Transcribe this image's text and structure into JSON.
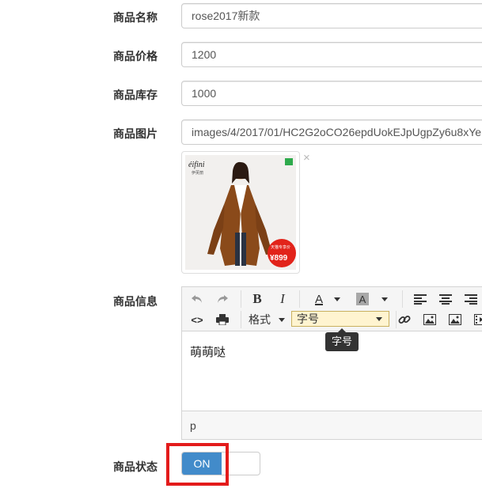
{
  "form": {
    "name_label": "商品名称",
    "name_value": "rose2017新款",
    "price_label": "商品价格",
    "price_value": "1200",
    "stock_label": "商品库存",
    "stock_value": "1000",
    "image_label": "商品图片",
    "image_path": "images/4/2017/01/HC2G2oCO26epdUokEJpUgpZy6u8xYe",
    "thumb_close": "×",
    "info_label": "商品信息",
    "status_label": "商品状态",
    "status_on": "ON"
  },
  "thumbnail": {
    "brand": "éifini",
    "brand_sub": "伊芙丽",
    "price_tag": "¥899",
    "promo": "天猫专享价"
  },
  "editor": {
    "bold": "B",
    "italic": "I",
    "font_color": "A",
    "bg_color": "A",
    "source_code": "<>",
    "format_label": "格式",
    "font_size_value": "字号",
    "tooltip": "字号",
    "content": "萌萌哒",
    "status_path": "p"
  }
}
